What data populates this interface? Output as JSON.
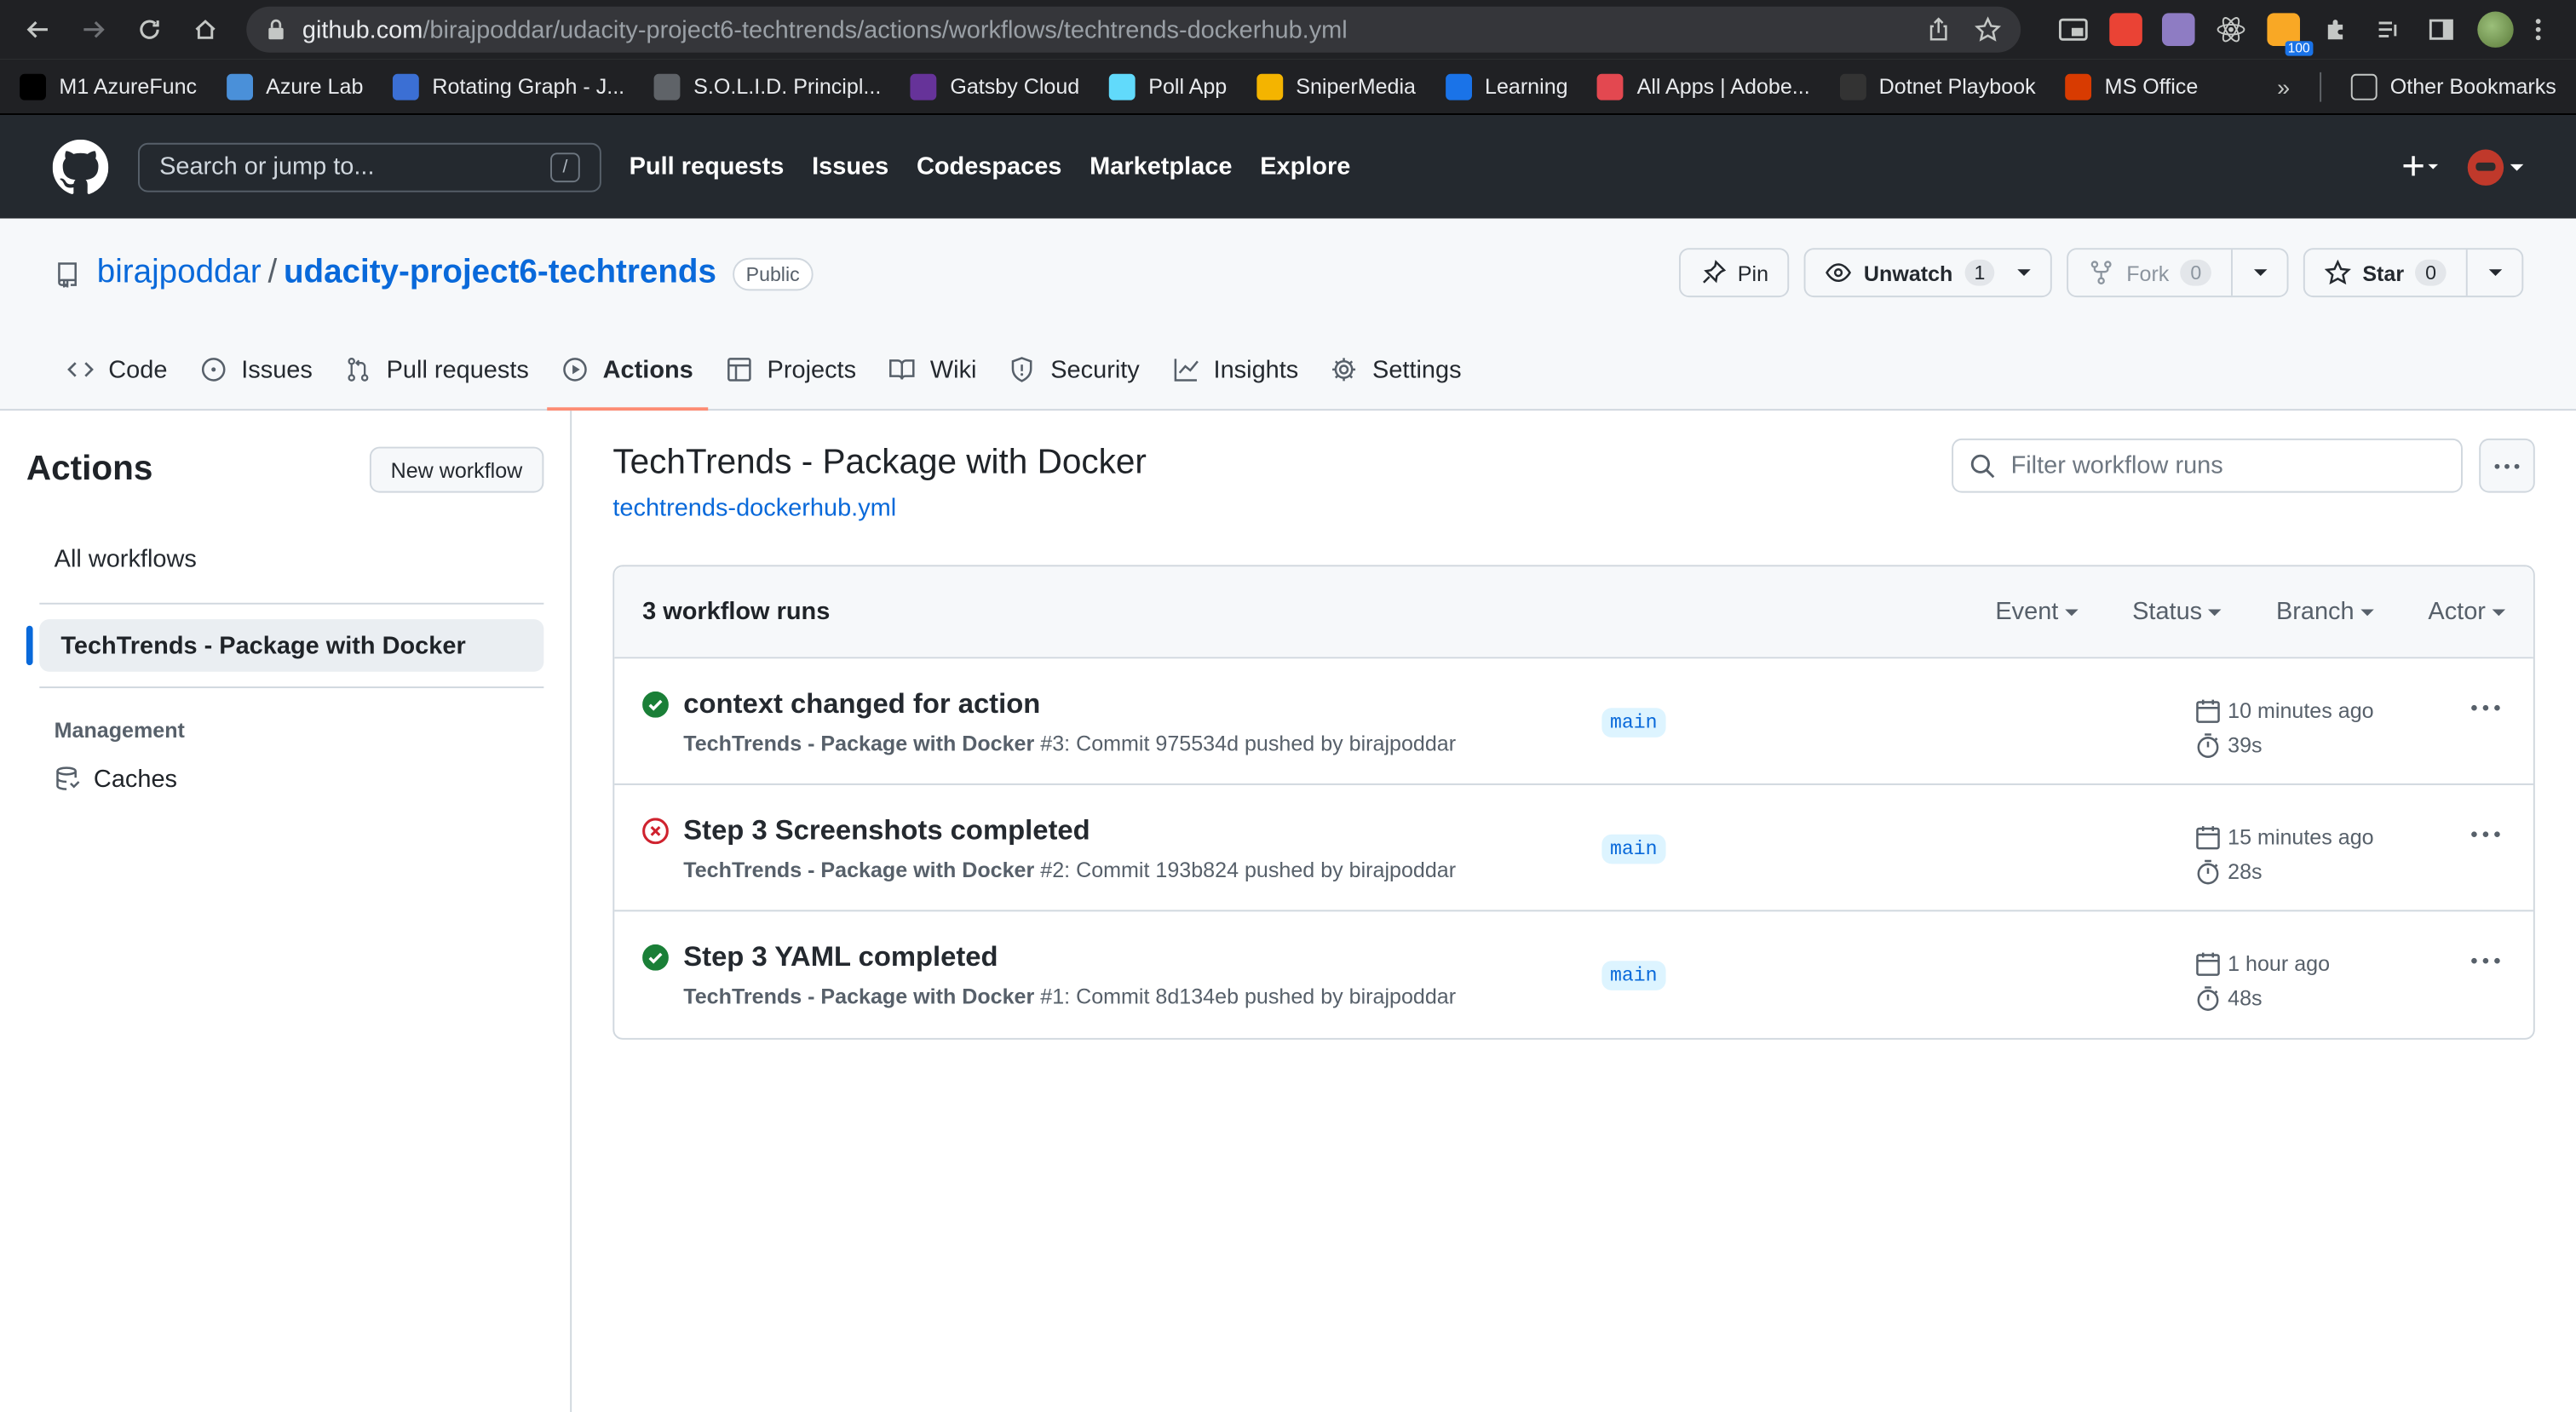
{
  "browser": {
    "url_host": "github.com",
    "url_path": "/birajpoddar/udacity-project6-techtrends/actions/workflows/techtrends-dockerhub.yml",
    "extension_badge": "100",
    "bookmarks": [
      {
        "label": "M1 AzureFunc",
        "icon": "github-icon",
        "color": "#000000"
      },
      {
        "label": "Azure Lab",
        "icon": "azure-lab-icon",
        "color": "#4a90d9"
      },
      {
        "label": "Rotating Graph - J...",
        "icon": "js-icon",
        "color": "#3b6fd4"
      },
      {
        "label": "S.O.L.I.D. Principl...",
        "icon": "doc-icon",
        "color": "#5f6368"
      },
      {
        "label": "Gatsby Cloud",
        "icon": "gatsby-icon",
        "color": "#663399"
      },
      {
        "label": "Poll App",
        "icon": "react-icon",
        "color": "#61dafb"
      },
      {
        "label": "SniperMedia",
        "icon": "drive-icon",
        "color": "#f4b400"
      },
      {
        "label": "Learning",
        "icon": "video-icon",
        "color": "#1a73e8"
      },
      {
        "label": "All Apps | Adobe...",
        "icon": "adobe-icon",
        "color": "#e34850"
      },
      {
        "label": "Dotnet Playbook",
        "icon": "dotnet-icon",
        "color": "#333333"
      },
      {
        "label": "MS Office",
        "icon": "office-icon",
        "color": "#d83b01"
      }
    ],
    "bookmarks_more": "»",
    "other_bookmarks": "Other Bookmarks"
  },
  "github": {
    "search_placeholder": "Search or jump to...",
    "search_key": "/",
    "nav": [
      "Pull requests",
      "Issues",
      "Codespaces",
      "Marketplace",
      "Explore"
    ]
  },
  "repo": {
    "owner": "birajpoddar",
    "separator": "/",
    "name": "udacity-project6-techtrends",
    "visibility": "Public",
    "pin_label": "Pin",
    "unwatch_label": "Unwatch",
    "unwatch_count": "1",
    "fork_label": "Fork",
    "fork_count": "0",
    "star_label": "Star",
    "star_count": "0",
    "tabs": [
      {
        "label": "Code",
        "icon": "code-icon"
      },
      {
        "label": "Issues",
        "icon": "issue-icon"
      },
      {
        "label": "Pull requests",
        "icon": "pull-request-icon"
      },
      {
        "label": "Actions",
        "icon": "play-icon",
        "selected": true
      },
      {
        "label": "Projects",
        "icon": "table-icon"
      },
      {
        "label": "Wiki",
        "icon": "book-icon"
      },
      {
        "label": "Security",
        "icon": "shield-icon"
      },
      {
        "label": "Insights",
        "icon": "graph-icon"
      },
      {
        "label": "Settings",
        "icon": "gear-icon"
      }
    ]
  },
  "sidebar": {
    "title": "Actions",
    "new_workflow": "New workflow",
    "all_workflows": "All workflows",
    "selected_workflow": "TechTrends - Package with Docker",
    "section": "Management",
    "caches": "Caches"
  },
  "workflow": {
    "title": "TechTrends - Package with Docker",
    "file": "techtrends-dockerhub.yml",
    "filter_placeholder": "Filter workflow runs",
    "runs_count": "3 workflow runs",
    "filters": [
      "Event",
      "Status",
      "Branch",
      "Actor"
    ],
    "runs": [
      {
        "title": "context changed for action",
        "status": "success",
        "workflow": "TechTrends - Package with Docker",
        "detail": "#3: Commit 975534d pushed by birajpoddar",
        "branch": "main",
        "when": "10 minutes ago",
        "duration": "39s"
      },
      {
        "title": "Step 3 Screenshots completed",
        "status": "failure",
        "workflow": "TechTrends - Package with Docker",
        "detail": "#2: Commit 193b824 pushed by birajpoddar",
        "branch": "main",
        "when": "15 minutes ago",
        "duration": "28s"
      },
      {
        "title": "Step 3 YAML completed",
        "status": "success",
        "workflow": "TechTrends - Package with Docker",
        "detail": "#1: Commit 8d134eb pushed by birajpoddar",
        "branch": "main",
        "when": "1 hour ago",
        "duration": "48s"
      }
    ]
  },
  "colors": {
    "success": "#1a7f37",
    "failure": "#cf222e",
    "accent": "#0969da",
    "tab_underline": "#fd8c73"
  }
}
